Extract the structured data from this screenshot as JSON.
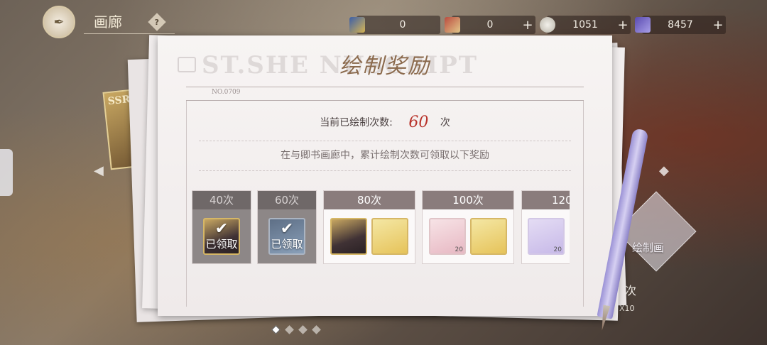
{
  "header": {
    "title": "画廊",
    "help_symbol": "?",
    "currencies": [
      {
        "icon": "paint-set-icon",
        "value": "0",
        "plus": ""
      },
      {
        "icon": "paint-box-icon",
        "value": "0",
        "plus": "+"
      },
      {
        "icon": "coin-icon",
        "value": "1051",
        "plus": "+"
      },
      {
        "icon": "gem-icon",
        "value": "8457",
        "plus": "+"
      }
    ]
  },
  "panel": {
    "watermark": "ST.SHE     NUSCRIPT",
    "title": "绘制奖励",
    "doc_number": "NO.0709",
    "count_label": "当前已绘制次数:",
    "count_value": "60",
    "count_unit": "次",
    "subtitle": "在与卿书画廊中，累计绘制次数可领取以下奖励"
  },
  "rewards": [
    {
      "label": "40次",
      "claimed": true,
      "claimed_text": "已领取",
      "items": [
        {
          "icon": "avatar-item-icon"
        }
      ]
    },
    {
      "label": "60次",
      "claimed": true,
      "claimed_text": "已领取",
      "items": [
        {
          "icon": "gift-box-icon"
        }
      ]
    },
    {
      "label": "80次",
      "claimed": false,
      "items": [
        {
          "icon": "avatar-item-icon"
        },
        {
          "icon": "art-supply-bag-icon"
        }
      ]
    },
    {
      "label": "100次",
      "claimed": false,
      "items": [
        {
          "icon": "pink-gift-icon",
          "qty": "20"
        },
        {
          "icon": "art-supply-bag-icon"
        }
      ]
    },
    {
      "label": "120",
      "claimed": false,
      "items": [
        {
          "icon": "fairy-wand-icon",
          "qty": "20"
        }
      ]
    }
  ],
  "side": {
    "ssr_badge": "SSR",
    "draw_label": "绘制画",
    "times_label": "次",
    "multiplier": "X10"
  },
  "colors": {
    "accent_red": "#b8332b",
    "title_brown": "#8b6a4d",
    "header_gray": "#8a7c7c"
  }
}
